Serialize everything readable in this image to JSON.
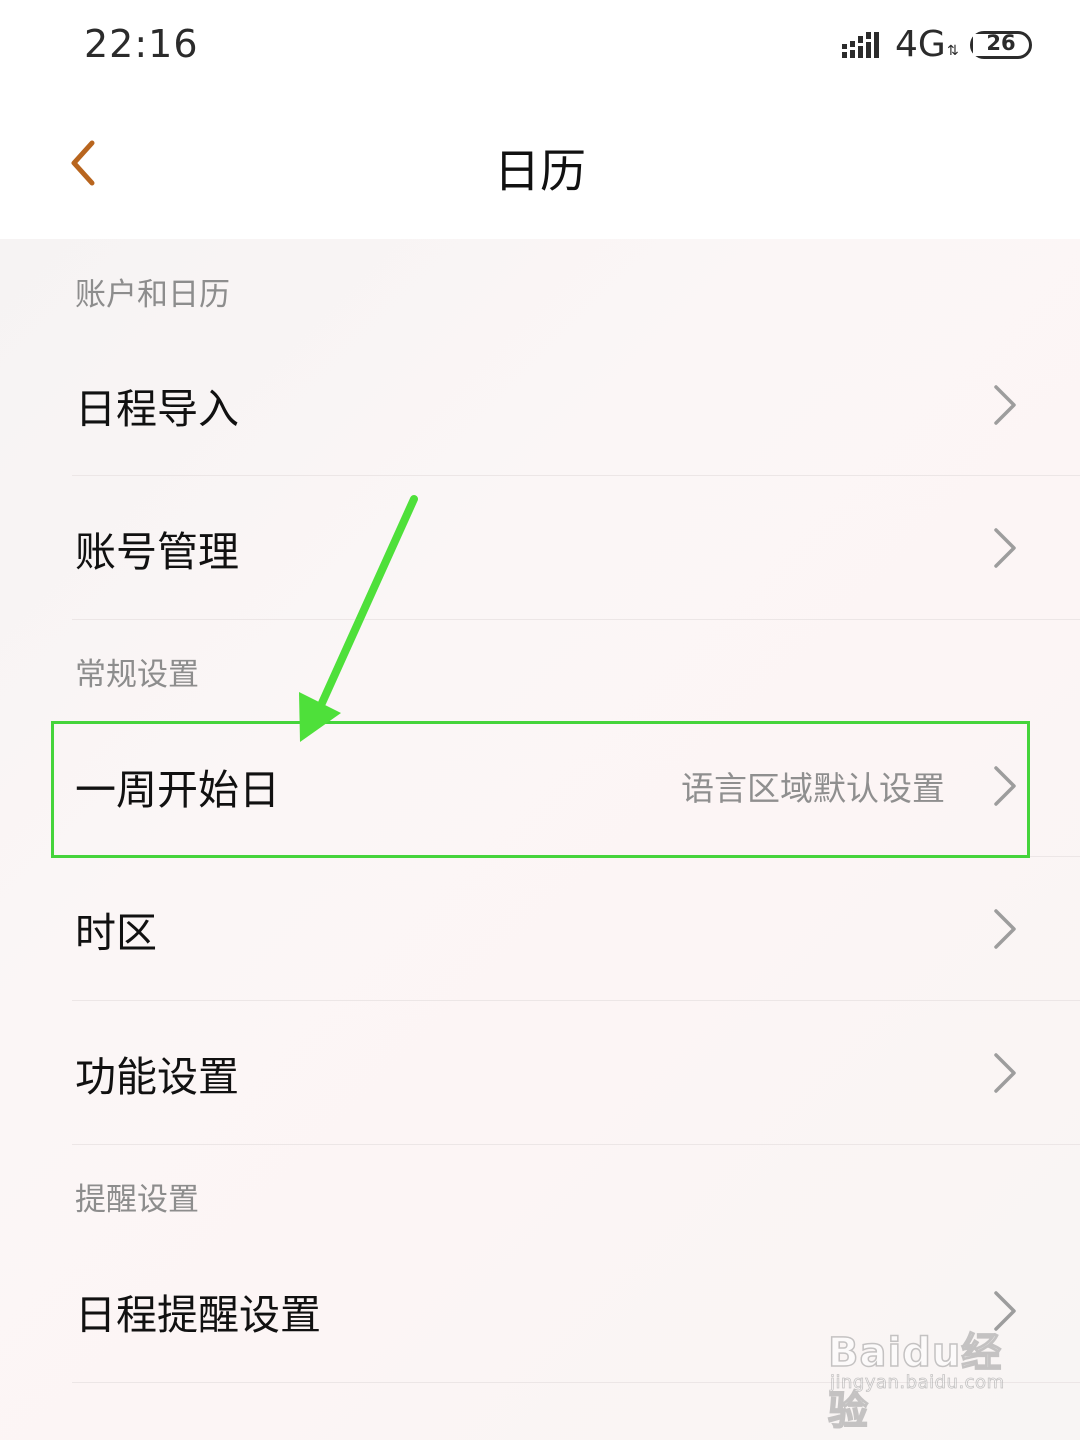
{
  "status_bar": {
    "time": "22:16",
    "network": "4G",
    "battery": "26",
    "battery_fraction": 0.26
  },
  "header": {
    "title": "日历",
    "back_icon": "chevron-left-icon"
  },
  "colors": {
    "accent": "#b8651e",
    "highlight": "#45d43b",
    "arrow": "#4ee03a"
  },
  "sections": [
    {
      "header": "账户和日历",
      "items": [
        {
          "label": "日程导入",
          "value": ""
        },
        {
          "label": "账号管理",
          "value": ""
        }
      ]
    },
    {
      "header": "常规设置",
      "items": [
        {
          "label": "一周开始日",
          "value": "语言区域默认设置"
        },
        {
          "label": "时区",
          "value": ""
        },
        {
          "label": "功能设置",
          "value": ""
        }
      ]
    },
    {
      "header": "提醒设置",
      "items": [
        {
          "label": "日程提醒设置",
          "value": ""
        }
      ]
    }
  ],
  "watermark": {
    "brand": "Baidu经验",
    "url": "jingyan.baidu.com"
  }
}
